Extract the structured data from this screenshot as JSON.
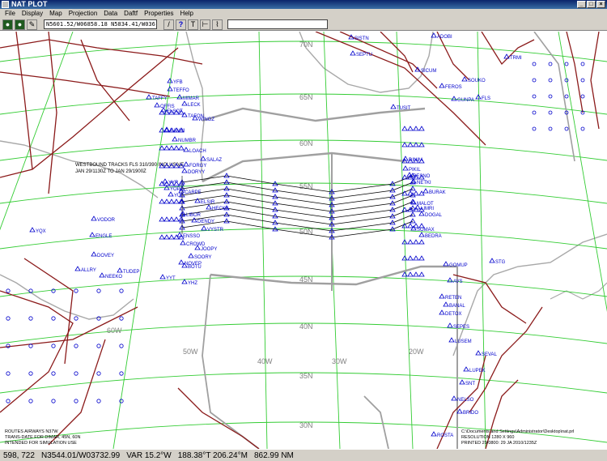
{
  "window": {
    "title": "NAT PLOT"
  },
  "menu": [
    "File",
    "Display",
    "Map",
    "Projection",
    "Data",
    "Daftf",
    "Properties",
    "Help"
  ],
  "toolbar": {
    "coords_value": "N5601.52/W06858.18 N5834.41/W036",
    "blank_value": ""
  },
  "map": {
    "lat_labels": [
      "70N",
      "65N",
      "60N",
      "55N",
      "50N",
      "45N",
      "40N",
      "35N",
      "30N"
    ],
    "lon_labels": [
      "60W",
      "50W",
      "40W",
      "30W",
      "20W"
    ],
    "tracks_note": [
      "WESTBOUND TRACKS FLS 310/390 INCLUSIVE",
      "JAN 29/1130Z TO JAN 29/1900Z"
    ],
    "bottom_left_note": [
      "ROUTES AIRWAYS N37W",
      "TRANS-DATE FOR DIMAR, 45N, 60N",
      "INTENDED FOR SIMULATION USE"
    ],
    "bottom_right_note": [
      "C:\\Documents and Settings\\Administrator\\Desktop\\nat.prl",
      "RESOLUTION 1280 X 960",
      "PRINTED 29/0800: 29 JA 2010/1235Z"
    ],
    "fixes_west": [
      "YFB",
      "TEFFO",
      "MIMAR",
      "LECK",
      "ELSOT",
      "TAFON",
      "LOACH",
      "FORGY",
      "DORYY",
      "YYR",
      "YOP",
      "YUL",
      "YQX",
      "YHZ",
      "YYT",
      "BOTU",
      "TUDEP",
      "ALLRY",
      "VODOR",
      "ENGLE",
      "DOVEY",
      "NEEKO",
      "TAFFY",
      "OFFIS",
      "KANNI",
      "NUMBR",
      "WINGZ",
      "SALAZ",
      "CARPE",
      "ELSIR",
      "HECKK",
      "LIBOR",
      "DENDY",
      "VYSTR",
      "ENSSO",
      "CROWD",
      "JOOPY",
      "SOORY",
      "NOVEP"
    ],
    "fixes_east": [
      "DINIM",
      "PIKIL",
      "RESNO",
      "NETKI",
      "BURAK",
      "SOMAX",
      "BEDRA",
      "MALOT",
      "LIMRI",
      "DOGAL",
      "GOMUP",
      "STG",
      "AVS",
      "RETEN",
      "BANAL",
      "DETOX",
      "SEPES",
      "LUSEM",
      "SEVAL",
      "LUPEK",
      "SNT",
      "NELSO",
      "BRIDO",
      "ROSTA",
      "GUNPA",
      "TUSIT",
      "FLS"
    ],
    "fixes_north": [
      "SISTN",
      "ADOBI",
      "SEPTU",
      "SICUM",
      "FEROS",
      "SOUKO",
      "TRMI"
    ]
  },
  "status": {
    "cursor_xy": "598, 722",
    "position": "N3544.01/W03732.99",
    "variation": "VAR  15.2°W",
    "bearing": "188.38°T 206.24°M",
    "distance": "862.99 NM"
  },
  "colors": {
    "graticule": "#33cc33",
    "coast": "#a8a8a8",
    "fir": "#a0a0a0",
    "track": "#000000",
    "airway": "#8b1a1a",
    "fix": "#0000cc"
  }
}
